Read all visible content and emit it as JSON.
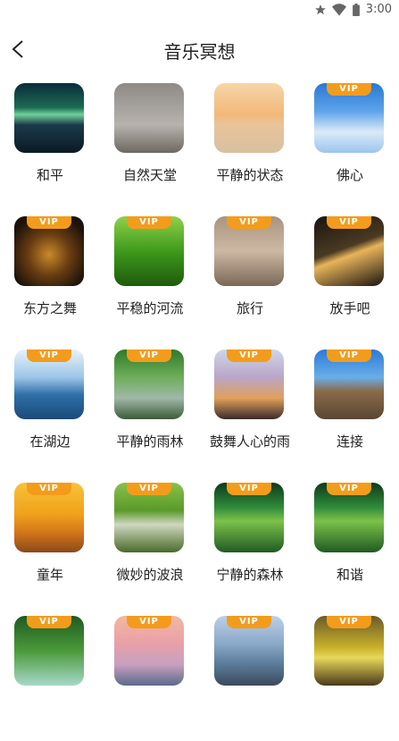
{
  "status": {
    "time": "3:00"
  },
  "header": {
    "title": "音乐冥想"
  },
  "vip_label": "VIP",
  "items": [
    {
      "label": "和平",
      "vip": false,
      "bg": "linear-gradient(180deg,#0b2a3a 0%,#1c6b54 35%,#6fd29a 45%,#1b3a4a 60%,#0a1a24 100%)"
    },
    {
      "label": "自然天堂",
      "vip": false,
      "bg": "linear-gradient(180deg,#8e8a86 0%,#b7b2ad 60%,#6d6862 100%)"
    },
    {
      "label": "平静的状态",
      "vip": false,
      "bg": "linear-gradient(180deg,#f6d6a8 0%,#f3b879 45%,#e8c49a 60%,#d9c0a0 100%)"
    },
    {
      "label": "佛心",
      "vip": true,
      "bg": "linear-gradient(180deg,#2a78d0 0%,#5da3ea 40%,#dbeaf8 70%,#9cc4ee 100%)"
    },
    {
      "label": "东方之舞",
      "vip": true,
      "bg": "radial-gradient(circle at 50% 55%,#c98a2a 0%,#6a3d12 40%,#1b120a 80%)"
    },
    {
      "label": "平稳的河流",
      "vip": true,
      "bg": "linear-gradient(180deg,#8fd14a 0%,#3e9a1c 50%,#1f5a0c 100%)"
    },
    {
      "label": "旅行",
      "vip": true,
      "bg": "linear-gradient(180deg,#a89480 0%,#cdb9a3 50%,#7a6756 100%)"
    },
    {
      "label": "放手吧",
      "vip": true,
      "bg": "linear-gradient(160deg,#1a1410 0%,#4a3a22 45%,#e8b45a 55%,#1a1410 100%)"
    },
    {
      "label": "在湖边",
      "vip": true,
      "bg": "linear-gradient(180deg,#e8f2fa 0%,#9cc6e8 40%,#2f6fa8 65%,#1b4a78 100%)"
    },
    {
      "label": "平静的雨林",
      "vip": true,
      "bg": "linear-gradient(180deg,#2f7a2a 0%,#6eae5a 40%,#9fb8a8 70%,#3d5a3a 100%)"
    },
    {
      "label": "鼓舞人心的雨",
      "vip": true,
      "bg": "linear-gradient(180deg,#cfd6e8 0%,#b9a6c8 40%,#e0a05a 70%,#3a2a2a 100%)"
    },
    {
      "label": "连接",
      "vip": true,
      "bg": "linear-gradient(180deg,#2a7ad8 0%,#6aaee8 40%,#8a6a4a 60%,#5a4632 100%)"
    },
    {
      "label": "童年",
      "vip": true,
      "bg": "linear-gradient(180deg,#f7c23a 0%,#f0a21a 45%,#d6781a 70%,#8a4a1a 100%)"
    },
    {
      "label": "微妙的波浪",
      "vip": true,
      "bg": "linear-gradient(180deg,#8ac14a 0%,#5a9a2a 40%,#cfd8c0 60%,#4a6a2a 100%)"
    },
    {
      "label": "宁静的森林",
      "vip": true,
      "bg": "linear-gradient(180deg,#0e3a1a 0%,#2f8a3a 35%,#7cc24a 55%,#1f5a22 100%)"
    },
    {
      "label": "和谐",
      "vip": true,
      "bg": "linear-gradient(180deg,#0e3a1a 0%,#2f8a3a 35%,#7cc24a 55%,#1f5a22 100%)"
    },
    {
      "label": "",
      "vip": true,
      "bg": "linear-gradient(180deg,#1f5a22 0%,#4a9a3a 50%,#a8d8c8 100%)"
    },
    {
      "label": "",
      "vip": true,
      "bg": "linear-gradient(180deg,#f2b8a0 0%,#e8a0a8 40%,#c7a0c0 70%,#5a6a8a 100%)"
    },
    {
      "label": "",
      "vip": true,
      "bg": "linear-gradient(180deg,#bcd0e8 0%,#8aa8c8 40%,#5a7a9a 70%,#3a4a5a 100%)"
    },
    {
      "label": "",
      "vip": true,
      "bg": "linear-gradient(180deg,#6a5a2a 0%,#c8b02a 45%,#e8d85a 60%,#4a3a1a 100%)"
    }
  ]
}
